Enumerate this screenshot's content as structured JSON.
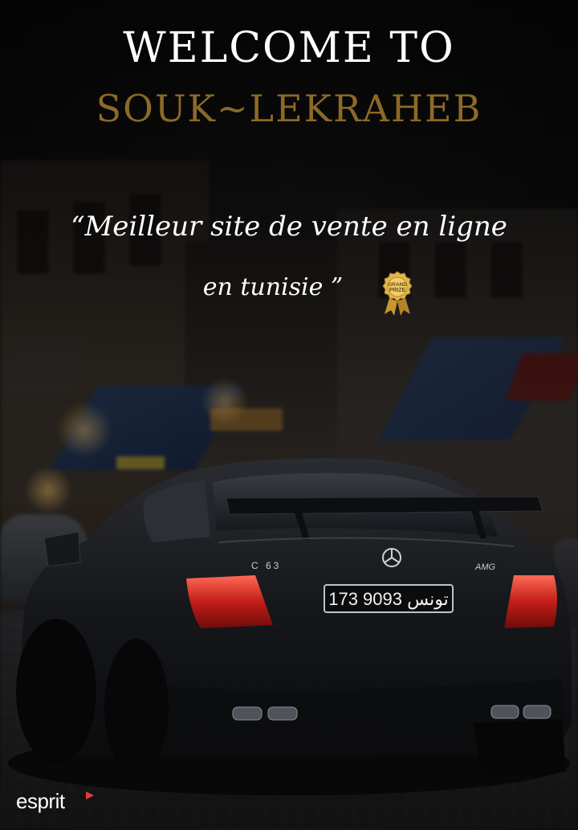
{
  "header": {
    "welcome": "WELCOME TO",
    "brand": "SOUK~LEKRAHEB"
  },
  "tagline": {
    "line1": "“Meilleur site de vente en ligne",
    "line2": "en tunisie ”",
    "badge_text": "GRAND PRIZE",
    "badge_icon": "award-medal-icon"
  },
  "car": {
    "model_badge": "C 63",
    "plate": "173 تونس 9093"
  },
  "footer": {
    "logo": "esprit"
  },
  "colors": {
    "brand_gold": "#8c6a26",
    "title_white": "#ffffff",
    "badge_gold": "#d4a640",
    "logo_red": "#e53a3a"
  }
}
